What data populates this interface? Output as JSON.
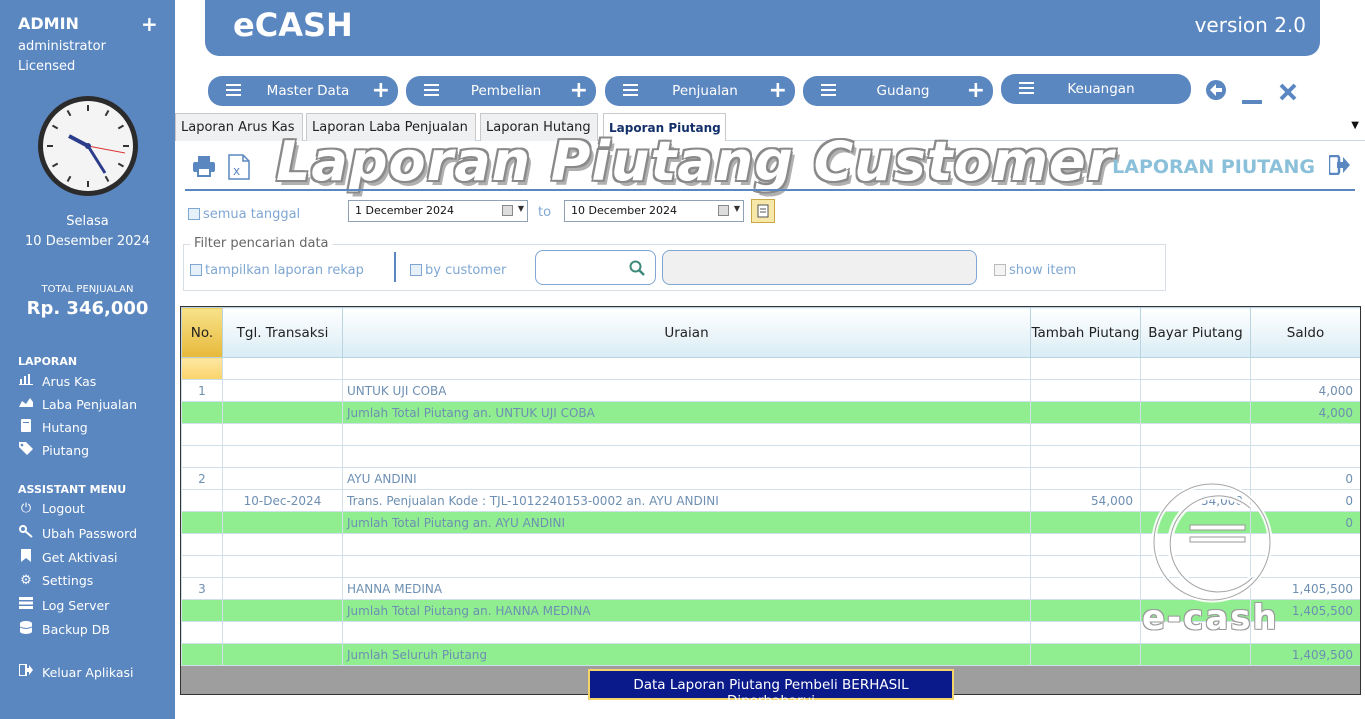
{
  "sidebar": {
    "user": "ADMIN",
    "role": "administrator",
    "license": "Licensed",
    "day": "Selasa",
    "date": "10 Desember 2024",
    "total_label": "TOTAL PENJUALAN",
    "total_value": "Rp. 346,000",
    "laporan_title": "LAPORAN",
    "laporan_items": [
      "Arus Kas",
      "Laba Penjualan",
      "Hutang",
      "Piutang"
    ],
    "assistant_title": "ASSISTANT MENU",
    "assistant_items": [
      "Logout",
      "Ubah Password",
      "Get Aktivasi",
      "Settings",
      "Log Server",
      "Backup DB"
    ],
    "exit": "Keluar Aplikasi"
  },
  "header": {
    "title": "eCASH",
    "version": "version 2.0"
  },
  "menu": [
    "Master Data",
    "Pembelian",
    "Penjualan",
    "Gudang",
    "Keuangan"
  ],
  "tabs": [
    "Laporan Arus Kas",
    "Laporan Laba Penjualan",
    "Laporan Hutang",
    "Laporan Piutang"
  ],
  "report": {
    "big_title": "Laporan Piutang Customer",
    "section_title": "LAPORAN PIUTANG"
  },
  "filter": {
    "all_dates": "semua tanggal",
    "date_from": "1  December  2024",
    "to": "to",
    "date_to": "10  December  2024",
    "legend": "Filter pencarian data",
    "rekap": "tampilkan laporan rekap",
    "by_customer": "by customer",
    "show_item": "show item"
  },
  "table": {
    "headers": [
      "No.",
      "Tgl. Transaksi",
      "Uraian",
      "Tambah Piutang",
      "Bayar Piutang",
      "Saldo"
    ],
    "rows": [
      {
        "type": "blank",
        "cells": [
          "",
          "",
          "",
          "",
          "",
          ""
        ]
      },
      {
        "type": "normal",
        "cells": [
          "1",
          "",
          "UNTUK UJI COBA",
          "",
          "",
          "4,000"
        ]
      },
      {
        "type": "green",
        "cells": [
          "",
          "",
          "Jumlah Total Piutang an. UNTUK UJI COBA",
          "",
          "",
          "4,000"
        ]
      },
      {
        "type": "normal",
        "cells": [
          "",
          "",
          "",
          "",
          "",
          ""
        ]
      },
      {
        "type": "normal",
        "cells": [
          "",
          "",
          "",
          "",
          "",
          ""
        ]
      },
      {
        "type": "normal",
        "cells": [
          "2",
          "",
          "AYU ANDINI",
          "",
          "",
          "0"
        ]
      },
      {
        "type": "normal",
        "cells": [
          "",
          "10-Dec-2024",
          "Trans. Penjualan Kode : TJL-1012240153-0002 an. AYU ANDINI",
          "54,000",
          "54,000",
          "0"
        ]
      },
      {
        "type": "green",
        "cells": [
          "",
          "",
          "Jumlah Total Piutang an. AYU ANDINI",
          "",
          "",
          "0"
        ]
      },
      {
        "type": "normal",
        "cells": [
          "",
          "",
          "",
          "",
          "",
          ""
        ]
      },
      {
        "type": "normal",
        "cells": [
          "",
          "",
          "",
          "",
          "",
          ""
        ]
      },
      {
        "type": "normal",
        "cells": [
          "3",
          "",
          "HANNA MEDINA",
          "",
          "",
          "1,405,500"
        ]
      },
      {
        "type": "green",
        "cells": [
          "",
          "",
          "Jumlah Total Piutang an. HANNA MEDINA",
          "",
          "",
          "1,405,500"
        ]
      },
      {
        "type": "normal",
        "cells": [
          "",
          "",
          "",
          "",
          "",
          ""
        ]
      },
      {
        "type": "green",
        "cells": [
          "",
          "",
          "Jumlah Seluruh Piutang",
          "",
          "",
          "1,409,500"
        ]
      }
    ]
  },
  "status_message": "Data Laporan Piutang Pembeli BERHASIL Diperbaharui",
  "watermark": "e-cash",
  "colors": {
    "primary": "#5b87c0",
    "total_row": "#90ee90",
    "status_bg": "#0b1a8a",
    "accent_title": "#8ac0d9"
  }
}
